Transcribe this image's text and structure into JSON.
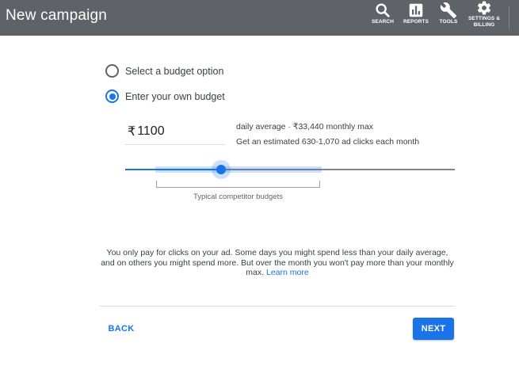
{
  "header": {
    "title": "New campaign",
    "tools": [
      {
        "label": "SEARCH",
        "icon": "search-icon"
      },
      {
        "label": "REPORTS",
        "icon": "bar-chart-icon"
      },
      {
        "label": "TOOLS",
        "icon": "wrench-icon"
      },
      {
        "label": "SETTINGS &\nBILLING",
        "icon": "gear-icon"
      }
    ]
  },
  "budget_options": [
    {
      "label": "Select a budget option",
      "selected": false
    },
    {
      "label": "Enter your own budget",
      "selected": true
    }
  ],
  "budget": {
    "currency": "₹",
    "amount": "1100",
    "info_line1": "daily average · ₹33,440 monthly max",
    "info_line2": "Get an estimated 630-1,070 ad clicks each month"
  },
  "slider": {
    "level_fraction": 0.29,
    "typical_range_fraction": [
      0.09,
      0.6
    ],
    "range_label": "Typical competitor budgets"
  },
  "note": {
    "text": "You only pay for clicks on your ad. Some days you might spend less than your daily average, and on others you might spend more. But over the month you won't pay more than your monthly max.",
    "link": "Learn more"
  },
  "footer": {
    "back_label": "BACK",
    "next_label": "NEXT"
  },
  "colors": {
    "header_bg": "#5f6368",
    "accent": "#1a73e8",
    "text": "#3c4043"
  }
}
